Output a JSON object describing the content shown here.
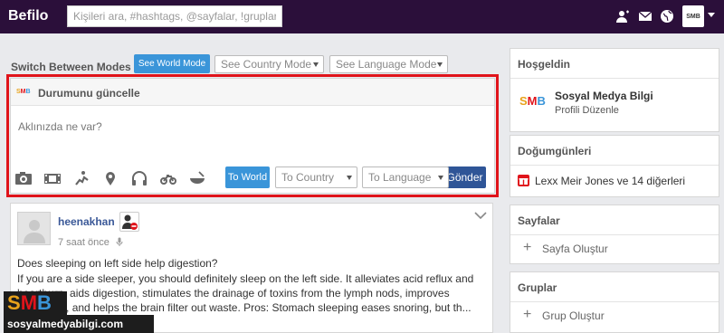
{
  "app": {
    "name": "Befilo"
  },
  "header": {
    "search_placeholder": "Kişileri ara, #hashtags, @sayfalar, !gruplar",
    "avatar_label": "SMB"
  },
  "modes": {
    "label": "Switch Between Modes",
    "world_button": "See World Mode",
    "country_select": "See Country Mode",
    "language_select": "See Language Mode"
  },
  "composer": {
    "logo": "SMB",
    "title": "Durumunu güncelle",
    "placeholder": "Aklınızda ne var?",
    "to_world": "To World",
    "to_country": "To Country",
    "to_language": "To Language",
    "send": "Gönder",
    "tools": [
      "camera-icon",
      "film-icon",
      "activity-icon",
      "location-icon",
      "headphones-icon",
      "bike-icon",
      "food-bowl-icon"
    ]
  },
  "post": {
    "username": "heenakhan",
    "time": "7 saat önce",
    "question": "Does sleeping on left side help digestion?",
    "body": "If you are a side sleeper, you should definitely sleep on the left side. It alleviates acid reflux and heartburn, aids digestion, stimulates the drainage of toxins from the lymph nods, improves circulation, and helps the brain filter out waste. Pros: Stomach sleeping eases snoring, but th..."
  },
  "sidebar": {
    "welcome": {
      "title": "Hoşgeldin",
      "logo": "SMB",
      "name": "Sosyal Medya Bilgi",
      "edit": "Profili Düzenle"
    },
    "birthdays": {
      "title": "Doğumgünleri",
      "text": "Lexx Meir Jones ve 14 diğerleri"
    },
    "pages": {
      "title": "Sayfalar",
      "action": "Sayfa Oluştur"
    },
    "groups": {
      "title": "Gruplar",
      "action": "Grup Oluştur"
    }
  },
  "watermark": {
    "logo": "SMB",
    "site": "sosyalmedyabilgi.com"
  },
  "colors": {
    "topbar": "#2b0f3a",
    "accent": "#3a95d9",
    "send": "#2f5597",
    "highlight": "#e0141b"
  }
}
